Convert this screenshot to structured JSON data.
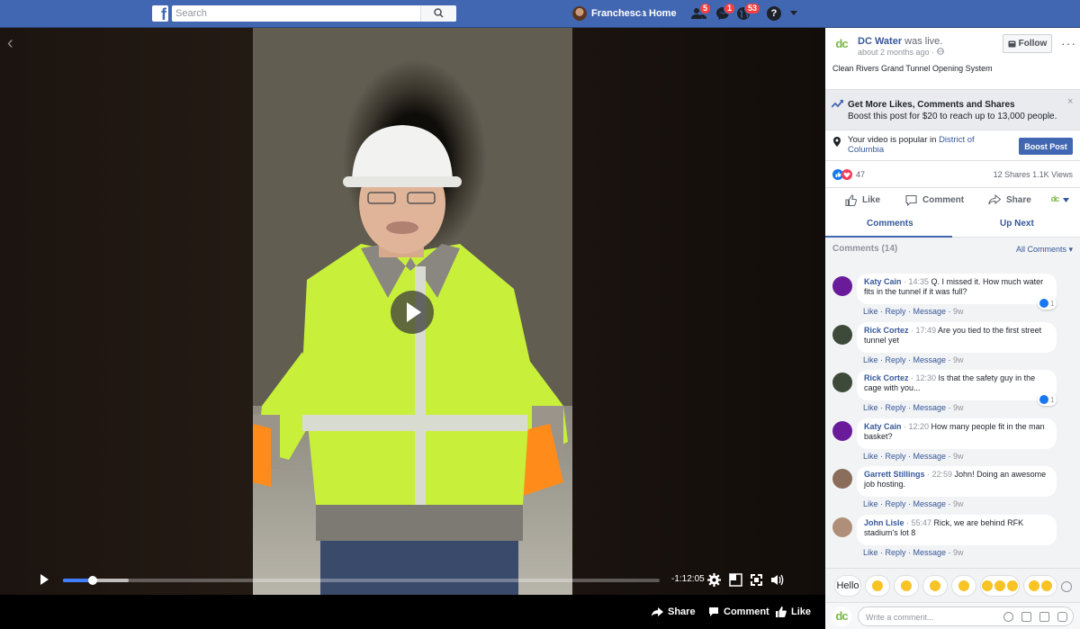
{
  "topbar": {
    "logo_letter": "f",
    "search_placeholder": "Search",
    "user_name": "Franchesca",
    "home_label": "Home",
    "friend_requests_badge": "5",
    "messages_badge": "1",
    "notifications_badge": "53",
    "help_label": "?"
  },
  "video": {
    "back_glyph": "‹",
    "time_remaining": "-1:12:05",
    "played_fraction": 0.05,
    "buffered_fraction": 0.11,
    "actions": {
      "share": "Share",
      "comment": "Comment",
      "like": "Like"
    }
  },
  "post": {
    "page_logo": "dc",
    "page_name": "DC Water",
    "status": "was live.",
    "time": "about 2 months ago · ",
    "follow_label": "Follow",
    "more": "···",
    "title": "Clean Rivers Grand Tunnel Opening System",
    "boost_title": "Get More Likes, Comments and Shares",
    "boost_sub": "Boost this post for $20 to reach up to 13,000 people.",
    "boost_close": "×",
    "popular_text": "Your video is popular in ",
    "popular_place": "District of Columbia",
    "boost_button": "Boost Post",
    "reaction_count": "47",
    "shares_views": "12 Shares  1.1K Views",
    "actions": {
      "like": "Like",
      "comment": "Comment",
      "share": "Share"
    },
    "tabs": {
      "comments": "Comments",
      "up_next": "Up Next"
    }
  },
  "comments": {
    "header": "Comments (14)",
    "all_comments": "All Comments ▾",
    "items": [
      {
        "name": "Katy Cain",
        "time": " · 14:35 ",
        "text": "Q. I missed it. How much water fits in the tunnel if it was full?",
        "links": "Like · Reply · Message · ",
        "age": "9w",
        "reactions": "1",
        "avatar_color": "#6a1b9a"
      },
      {
        "name": "Rick Cortez",
        "time": " · 17:49 ",
        "text": "Are you tied to the first street tunnel yet",
        "links": "Like · Reply · Message · ",
        "age": "9w",
        "reactions": "",
        "avatar_color": "#3d4a3a"
      },
      {
        "name": "Rick Cortez",
        "time": " · 12:30 ",
        "text": "Is that the safety guy in the cage with you...",
        "links": "Like · Reply · Message · ",
        "age": "9w",
        "reactions": "1",
        "avatar_color": "#3d4a3a"
      },
      {
        "name": "Katy Cain",
        "time": " · 12:20 ",
        "text": "How many people fit in the man basket?",
        "links": "Like · Reply · Message · ",
        "age": "9w",
        "reactions": "",
        "avatar_color": "#6a1b9a"
      },
      {
        "name": "Garrett Stillings",
        "time": " · 22:59 ",
        "text": "John! Doing an awesome job hosting.",
        "links": "Like · Reply · Message · ",
        "age": "9w",
        "reactions": "",
        "avatar_color": "#8a6d5a"
      },
      {
        "name": "John Lisle",
        "time": " · 55:47 ",
        "text": "Rick, we are behind RFK stadium's lot 8",
        "links": "Like · Reply · Message · ",
        "age": "9w",
        "reactions": "",
        "avatar_color": "#b08f7a"
      }
    ]
  },
  "stickers": {
    "hello": "Hello"
  },
  "write": {
    "placeholder": "Write a comment..."
  },
  "colors": {
    "brand": "#4267b2",
    "link": "#365899",
    "progress": "#4080ff",
    "badge": "#fa3e3e"
  }
}
